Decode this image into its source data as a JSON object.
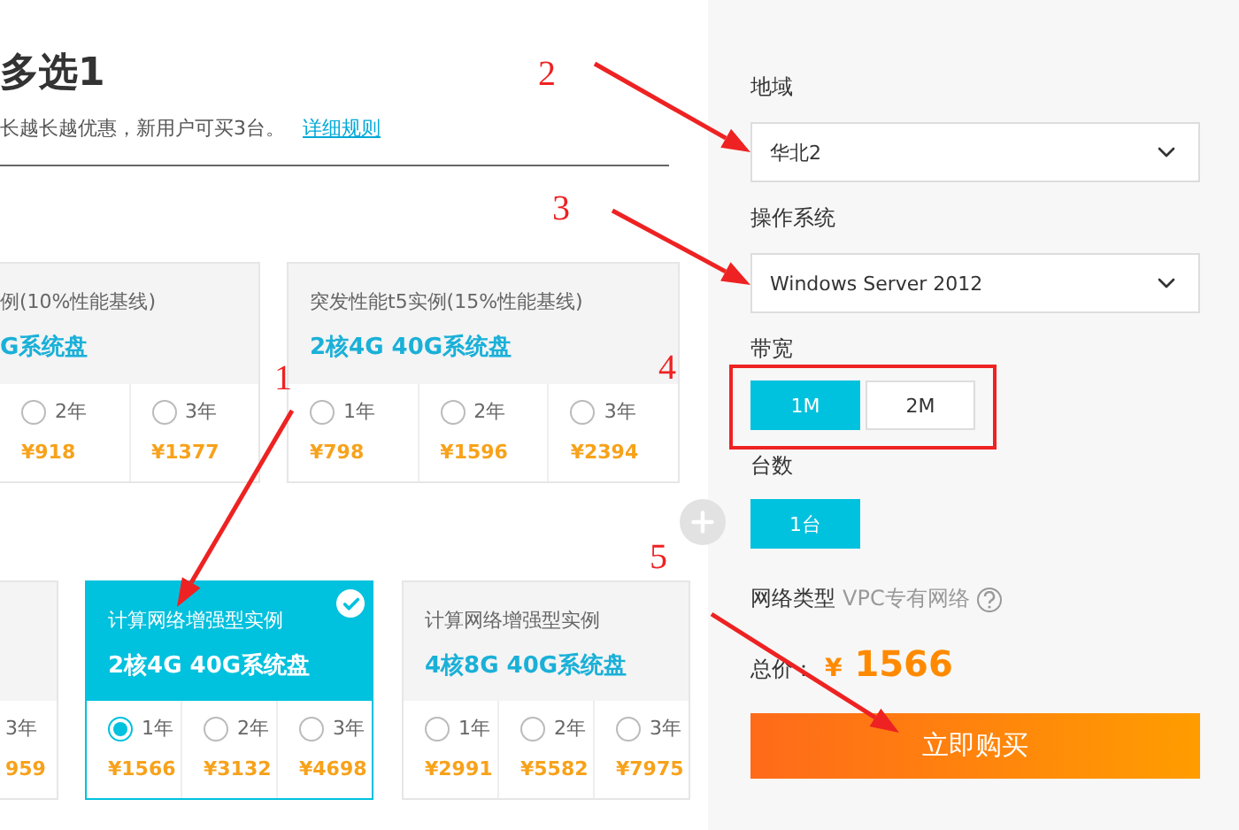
{
  "page": {
    "title": "多选1",
    "subtitle": "长越长越优惠，新用户可买3台。",
    "rules_link": "详细规则"
  },
  "plan_rows": [
    {
      "cards": [
        {
          "cut": true,
          "title": "例(10%性能基线)",
          "spec": "G系统盘",
          "selected": false,
          "options": [
            {
              "label": "2年",
              "price": "¥918",
              "selected": false
            },
            {
              "label": "3年",
              "price": "¥1377",
              "selected": false
            }
          ]
        },
        {
          "cut": false,
          "title": "突发性能t5实例(15%性能基线)",
          "spec": "2核4G 40G系统盘",
          "selected": false,
          "options": [
            {
              "label": "1年",
              "price": "¥798",
              "selected": false
            },
            {
              "label": "2年",
              "price": "¥1596",
              "selected": false
            },
            {
              "label": "3年",
              "price": "¥2394",
              "selected": false
            }
          ]
        }
      ]
    },
    {
      "cards": [
        {
          "cut": true,
          "selected": false,
          "options": [
            {
              "label": "3年",
              "price": "959"
            }
          ]
        },
        {
          "cut": false,
          "title": "计算网络增强型实例",
          "spec": "2核4G 40G系统盘",
          "selected": true,
          "options": [
            {
              "label": "1年",
              "price": "¥1566",
              "selected": true
            },
            {
              "label": "2年",
              "price": "¥3132",
              "selected": false
            },
            {
              "label": "3年",
              "price": "¥4698",
              "selected": false
            }
          ]
        },
        {
          "cut": false,
          "title": "计算网络增强型实例",
          "spec": "4核8G 40G系统盘",
          "selected": false,
          "options": [
            {
              "label": "1年",
              "price": "¥2991",
              "selected": false
            },
            {
              "label": "2年",
              "price": "¥5582",
              "selected": false
            },
            {
              "label": "3年",
              "price": "¥7975",
              "selected": false
            }
          ]
        }
      ]
    }
  ],
  "order": {
    "region": {
      "label": "地域",
      "value": "华北2"
    },
    "os": {
      "label": "操作系统",
      "value": "Windows Server 2012"
    },
    "bandwidth": {
      "label": "带宽",
      "options": [
        {
          "label": "1M",
          "selected": true
        },
        {
          "label": "2M",
          "selected": false
        }
      ]
    },
    "quantity": {
      "label": "台数",
      "options": [
        {
          "label": "1台",
          "selected": true
        }
      ]
    },
    "network": {
      "label": "网络类型",
      "value": "VPC专有网络"
    },
    "total": {
      "label": "总价：",
      "currency": "¥",
      "amount": "1566"
    },
    "buy_button": "立即购买"
  },
  "annotations": [
    "1",
    "2",
    "3",
    "4",
    "5"
  ]
}
